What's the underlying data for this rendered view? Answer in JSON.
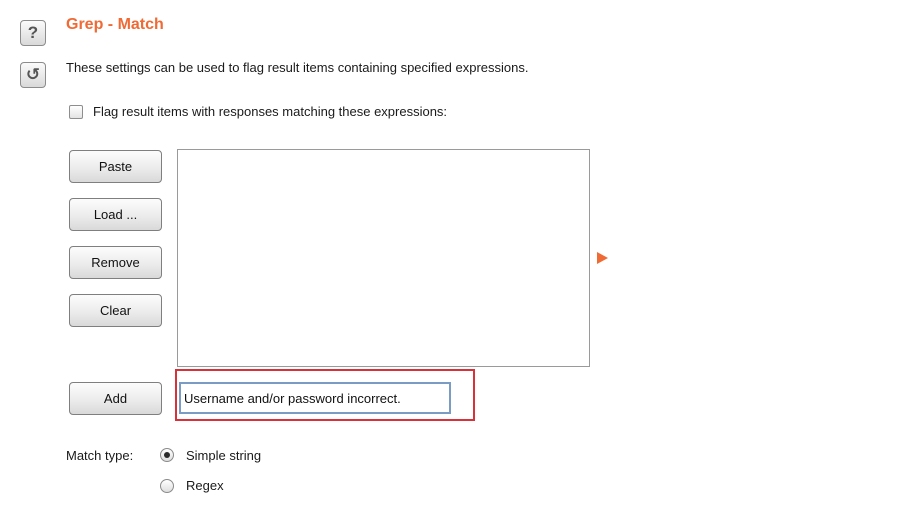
{
  "side_buttons": {
    "help_glyph": "?",
    "help_icon": "question-mark-icon",
    "reset_glyph": "↺",
    "reset_icon": "refresh-icon"
  },
  "section": {
    "title": "Grep - Match",
    "description": "These settings can be used to flag result items containing specified expressions."
  },
  "flag_option": {
    "label": "Flag result items with responses matching these expressions:",
    "checked": false
  },
  "buttons": {
    "paste": "Paste",
    "load": "Load ...",
    "remove": "Remove",
    "clear": "Clear",
    "add": "Add"
  },
  "expression_list": {
    "items": []
  },
  "add_field": {
    "value": "Username and/or password incorrect."
  },
  "match_type": {
    "label": "Match type:",
    "options": [
      {
        "label": "Simple string",
        "selected": true
      },
      {
        "label": "Regex",
        "selected": false
      }
    ]
  },
  "colors": {
    "accent": "#f06a35",
    "highlight_box": "#d9313a",
    "input_focus_border": "#7a9cc4"
  }
}
